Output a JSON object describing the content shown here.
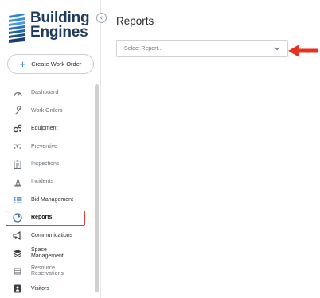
{
  "brand": {
    "line1": "Building",
    "line2": "Engines",
    "icon": "building-logo"
  },
  "sidebar": {
    "collapse_icon": "chevron-left-icon",
    "collapse_glyph": "‹",
    "create_button": {
      "label": "Create Work Order",
      "icon": "plus-icon",
      "glyph": "+"
    },
    "items": [
      {
        "label": "Dashboard",
        "icon": "gauge-icon"
      },
      {
        "label": "Work Orders",
        "icon": "wrench-icon"
      },
      {
        "label": "Equipment",
        "icon": "gears-icon"
      },
      {
        "label": "Preventive",
        "icon": "preventive-icon"
      },
      {
        "label": "Inspections",
        "icon": "clipboard-icon"
      },
      {
        "label": "Incidents",
        "icon": "cone-icon"
      },
      {
        "label": "Bid Management",
        "icon": "list-icon"
      },
      {
        "label": "Reports",
        "icon": "reports-icon"
      },
      {
        "label": "Communications",
        "icon": "megaphone-icon"
      },
      {
        "label": "Space Management",
        "icon": "layers-icon"
      },
      {
        "label": "Resource Reservations",
        "icon": "reservations-icon"
      },
      {
        "label": "Visitors",
        "icon": "visitor-badge-icon"
      }
    ],
    "active_item": "Reports"
  },
  "main": {
    "title": "Reports",
    "select": {
      "placeholder": "Select Report...",
      "icon": "chevron-down-icon"
    }
  },
  "annotation": {
    "icon": "red-arrow-icon",
    "color": "#e8321f"
  },
  "colors": {
    "accent": "#2d7dd2",
    "highlight": "#e0413a",
    "brand": "#1d3a5f"
  }
}
